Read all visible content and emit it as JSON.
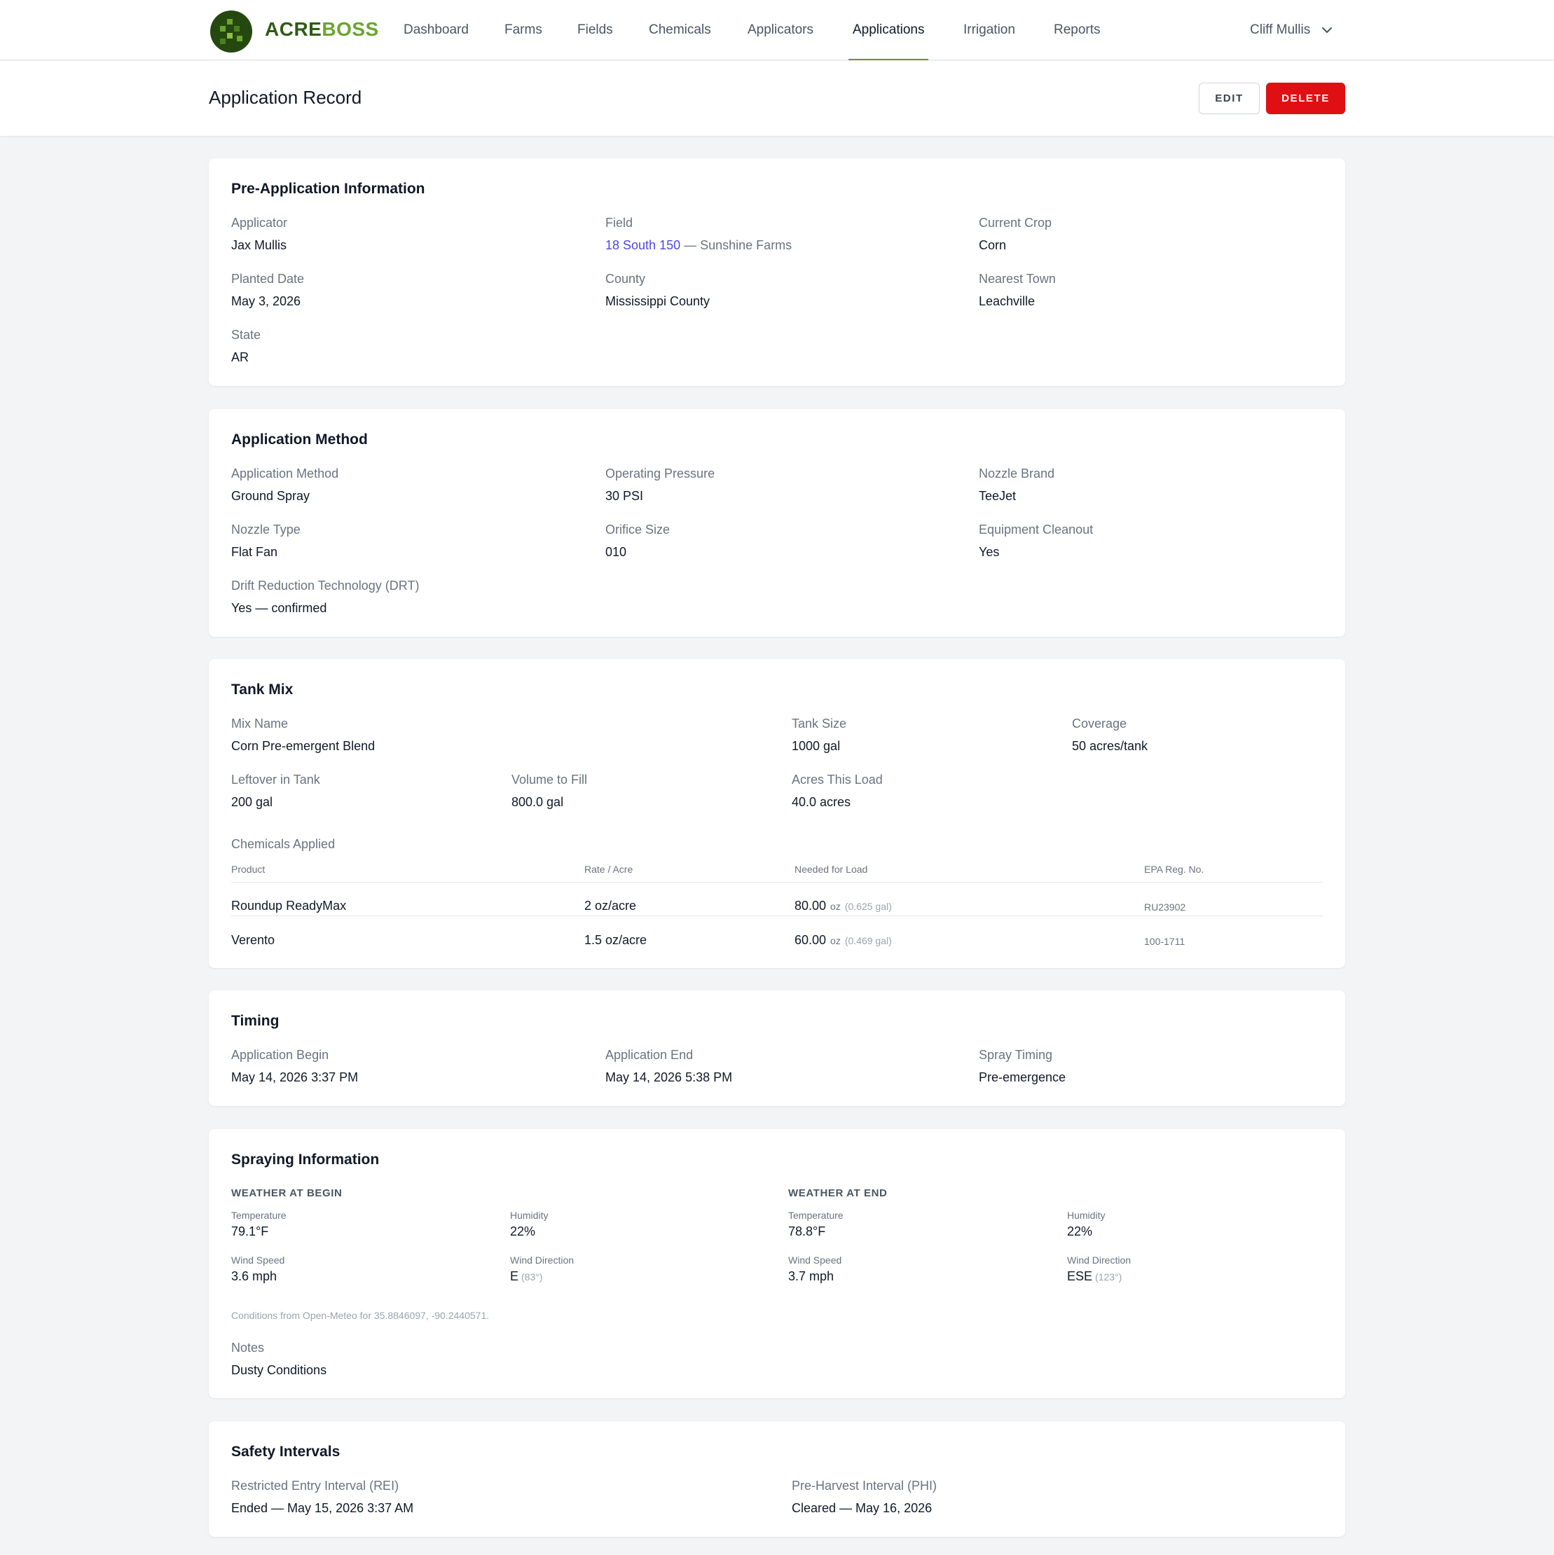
{
  "brand": {
    "part1": "ACRE",
    "part2": "BOSS",
    "icon": "acreboss-logo-icon",
    "dark": "#2f5c15",
    "light": "#6aa52c"
  },
  "nav": {
    "items": [
      "Dashboard",
      "Farms",
      "Fields",
      "Chemicals",
      "Applicators",
      "Applications",
      "Irrigation",
      "Reports"
    ],
    "active": "Applications",
    "user": "Cliff Mullis",
    "user_icon": "chevron-down-icon"
  },
  "header": {
    "title": "Application Record",
    "edit_label": "EDIT",
    "delete_label": "DELETE",
    "delete_color": "#e00f14"
  },
  "pre_application": {
    "title": "Pre-Application Information",
    "applicator": {
      "label": "Applicator",
      "value": "Jax Mullis"
    },
    "field": {
      "label": "Field",
      "value": "18 South 150",
      "farm": "— Sunshine Farms"
    },
    "current_crop": {
      "label": "Current Crop",
      "value": "Corn"
    },
    "planted_date": {
      "label": "Planted Date",
      "value": "May 3, 2026"
    },
    "county": {
      "label": "County",
      "value": "Mississippi County"
    },
    "nearest_town": {
      "label": "Nearest Town",
      "value": "Leachville"
    },
    "state": {
      "label": "State",
      "value": "AR"
    }
  },
  "application_method": {
    "title": "Application Method",
    "method": {
      "label": "Application Method",
      "value": "Ground Spray"
    },
    "pressure": {
      "label": "Operating Pressure",
      "value": "30 PSI"
    },
    "nozzle_brand": {
      "label": "Nozzle Brand",
      "value": "TeeJet"
    },
    "nozzle_type": {
      "label": "Nozzle Type",
      "value": "Flat Fan"
    },
    "orifice": {
      "label": "Orifice Size",
      "value": "010"
    },
    "cleanout": {
      "label": "Equipment Cleanout",
      "value": "Yes"
    },
    "drt": {
      "label": "Drift Reduction Technology (DRT)",
      "value": "Yes — confirmed"
    }
  },
  "tank_mix": {
    "title": "Tank Mix",
    "mix_name": {
      "label": "Mix Name",
      "value": "Corn Pre-emergent Blend"
    },
    "tank_size": {
      "label": "Tank Size",
      "value": "1000 gal"
    },
    "coverage": {
      "label": "Coverage",
      "value": "50 acres/tank"
    },
    "leftover": {
      "label": "Leftover in Tank",
      "value": "200 gal"
    },
    "volume_fill": {
      "label": "Volume to Fill",
      "value": "800.0 gal"
    },
    "acres_load": {
      "label": "Acres This Load",
      "value": "40.0 acres"
    },
    "chemicals_label": "Chemicals Applied",
    "columns": {
      "product": "Product",
      "rate": "Rate / Acre",
      "needed": "Needed for Load",
      "epa": "EPA Reg. No."
    },
    "rows": [
      {
        "product": "Roundup ReadyMax",
        "rate": "2 oz/acre",
        "needed": "80.00",
        "unit": "oz",
        "gal": "(0.625 gal)",
        "epa": "RU23902"
      },
      {
        "product": "Verento",
        "rate": "1.5 oz/acre",
        "needed": "60.00",
        "unit": "oz",
        "gal": "(0.469 gal)",
        "epa": "100-1711"
      }
    ]
  },
  "timing": {
    "title": "Timing",
    "begin": {
      "label": "Application Begin",
      "value": "May 14, 2026 3:37 PM"
    },
    "end": {
      "label": "Application End",
      "value": "May 14, 2026 5:38 PM"
    },
    "spray_timing": {
      "label": "Spray Timing",
      "value": "Pre-emergence"
    }
  },
  "spraying": {
    "title": "Spraying Information",
    "begin": {
      "heading": "WEATHER AT BEGIN",
      "temperature": {
        "label": "Temperature",
        "value": "79.1°F"
      },
      "humidity": {
        "label": "Humidity",
        "value": "22%"
      },
      "wind_speed": {
        "label": "Wind Speed",
        "value": "3.6 mph"
      },
      "wind_direction": {
        "label": "Wind Direction",
        "value": "E",
        "degrees": "(83°)"
      }
    },
    "end": {
      "heading": "WEATHER AT END",
      "temperature": {
        "label": "Temperature",
        "value": "78.8°F"
      },
      "humidity": {
        "label": "Humidity",
        "value": "22%"
      },
      "wind_speed": {
        "label": "Wind Speed",
        "value": "3.7 mph"
      },
      "wind_direction": {
        "label": "Wind Direction",
        "value": "ESE",
        "degrees": "(123°)"
      }
    },
    "source_note": "Conditions from Open-Meteo for 35.8846097, -90.2440571.",
    "notes": {
      "label": "Notes",
      "value": "Dusty Conditions"
    }
  },
  "safety": {
    "title": "Safety Intervals",
    "rei": {
      "label": "Restricted Entry Interval (REI)",
      "value": "Ended — May 15, 2026 3:37 AM"
    },
    "phi": {
      "label": "Pre-Harvest Interval (PHI)",
      "value": "Cleared — May 16, 2026"
    }
  },
  "colors": {
    "link": "#4f46e5",
    "accent": "#5c9a2b",
    "background": "#f3f4f6"
  }
}
